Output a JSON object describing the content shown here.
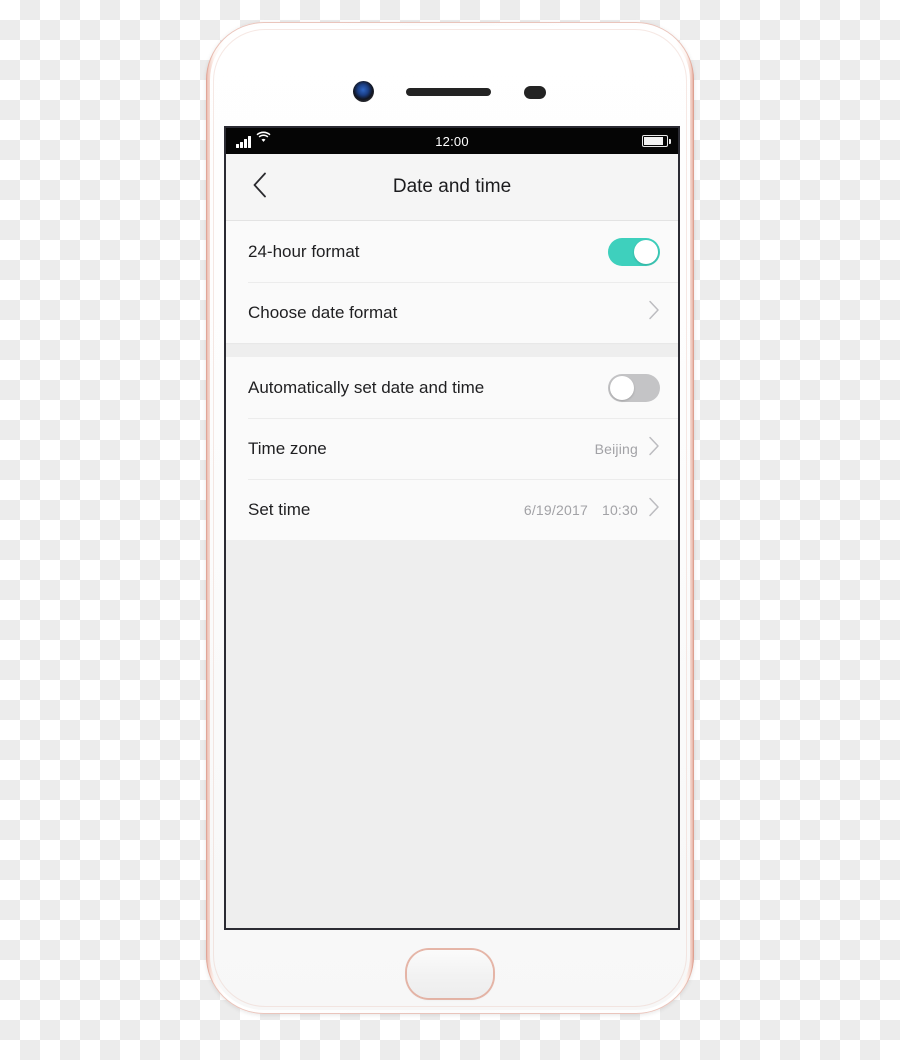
{
  "device": {
    "name": "smartphone-mockup",
    "frame_color": "#e8b4a8",
    "body_color": "#ffffff",
    "camera_icon": "front-camera-icon",
    "earpiece_icon": "earpiece-speaker-icon",
    "sensor_icon": "proximity-sensor-icon",
    "home_button_label": "home-button"
  },
  "status_bar": {
    "signal_icon": "cellular-signal-icon",
    "wifi_icon": "wifi-icon",
    "time": "12:00",
    "battery_icon": "battery-icon"
  },
  "nav": {
    "back_icon": "chevron-left-icon",
    "title": "Date and time"
  },
  "settings": {
    "groups": [
      {
        "rows": [
          {
            "name": "24-hour-format",
            "label": "24-hour format",
            "control": "toggle",
            "toggle_state": "on",
            "value": ""
          },
          {
            "name": "choose-date-format",
            "label": "Choose date format",
            "control": "chevron",
            "value": ""
          }
        ]
      },
      {
        "rows": [
          {
            "name": "automatically-set-date-and-time",
            "label": "Automatically set date and time",
            "control": "toggle",
            "toggle_state": "off",
            "value": ""
          },
          {
            "name": "time-zone",
            "label": "Time zone",
            "control": "chevron",
            "value": "Beijing"
          },
          {
            "name": "set-time",
            "label": "Set time",
            "control": "chevron",
            "value_date": "6/19/2017",
            "value_time": "10:30"
          }
        ]
      }
    ]
  },
  "colors": {
    "toggle_on": "#3ed0bd",
    "toggle_off": "#c4c4c6",
    "cell_background": "#fafafa",
    "page_background": "#eeeeee",
    "navbar_background": "#f5f5f5",
    "label_text": "#1f1f21",
    "value_text": "#a2a2a6"
  }
}
